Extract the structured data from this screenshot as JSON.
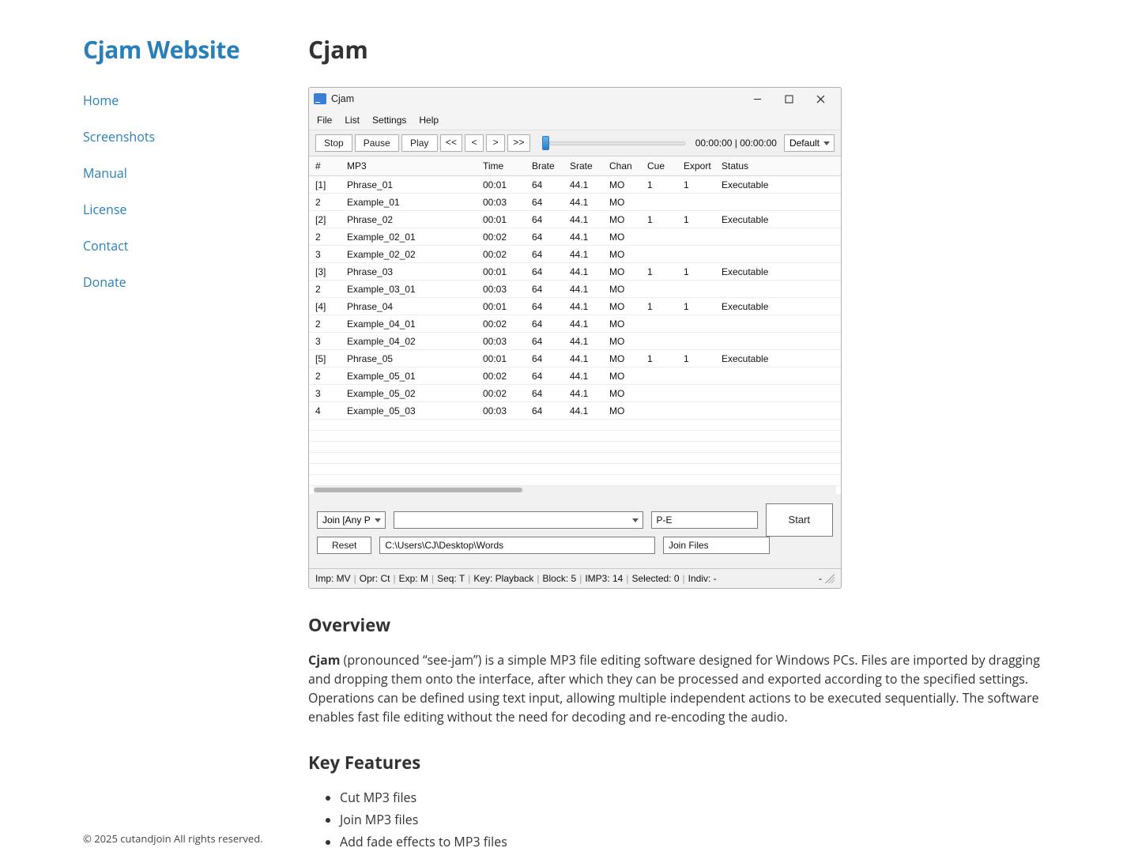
{
  "site": {
    "title": "Cjam Website",
    "nav": [
      {
        "label": "Home"
      },
      {
        "label": "Screenshots"
      },
      {
        "label": "Manual"
      },
      {
        "label": "License"
      },
      {
        "label": "Contact"
      },
      {
        "label": "Donate"
      }
    ],
    "copyright": "© 2025 cutandjoin All rights reserved."
  },
  "page": {
    "heading": "Cjam",
    "overview_heading": "Overview",
    "overview_strong": "Cjam",
    "overview_body": " (pronounced “see-jam”) is a simple MP3 file editing software designed for Windows PCs. Files are imported by dragging and dropping them onto the interface, after which they can be processed and exported according to the specified settings. Operations can be defined using text input, allowing multiple independent actions to be executed sequentially. The software enables fast file editing without the need for decoding and re-encoding the audio.",
    "features_heading": "Key Features",
    "features": [
      "Cut MP3 files",
      "Join MP3 files",
      "Add fade effects to MP3 files"
    ]
  },
  "app": {
    "title": "Cjam",
    "menubar": [
      "File",
      "List",
      "Settings",
      "Help"
    ],
    "toolbar": {
      "stop": "Stop",
      "pause": "Pause",
      "play": "Play",
      "rew2": "<<",
      "rew1": "<",
      "fwd1": ">",
      "fwd2": ">>",
      "time": "00:00:00 | 00:00:00",
      "preset": "Default"
    },
    "columns": [
      "#",
      "MP3",
      "Time",
      "Brate",
      "Srate",
      "Chan",
      "Cue",
      "Export",
      "Status"
    ],
    "rows": [
      {
        "n": "[1]",
        "mp3": "Phrase_01",
        "time": "00:01",
        "brate": "64",
        "srate": "44.1",
        "chan": "MO",
        "cue": "1",
        "export": "1",
        "status": "Executable"
      },
      {
        "n": "2",
        "mp3": "Example_01",
        "time": "00:03",
        "brate": "64",
        "srate": "44.1",
        "chan": "MO",
        "cue": "",
        "export": "",
        "status": ""
      },
      {
        "n": "[2]",
        "mp3": "Phrase_02",
        "time": "00:01",
        "brate": "64",
        "srate": "44.1",
        "chan": "MO",
        "cue": "1",
        "export": "1",
        "status": "Executable"
      },
      {
        "n": "2",
        "mp3": "Example_02_01",
        "time": "00:02",
        "brate": "64",
        "srate": "44.1",
        "chan": "MO",
        "cue": "",
        "export": "",
        "status": ""
      },
      {
        "n": "3",
        "mp3": "Example_02_02",
        "time": "00:02",
        "brate": "64",
        "srate": "44.1",
        "chan": "MO",
        "cue": "",
        "export": "",
        "status": ""
      },
      {
        "n": "[3]",
        "mp3": "Phrase_03",
        "time": "00:01",
        "brate": "64",
        "srate": "44.1",
        "chan": "MO",
        "cue": "1",
        "export": "1",
        "status": "Executable"
      },
      {
        "n": "2",
        "mp3": "Example_03_01",
        "time": "00:03",
        "brate": "64",
        "srate": "44.1",
        "chan": "MO",
        "cue": "",
        "export": "",
        "status": ""
      },
      {
        "n": "[4]",
        "mp3": "Phrase_04",
        "time": "00:01",
        "brate": "64",
        "srate": "44.1",
        "chan": "MO",
        "cue": "1",
        "export": "1",
        "status": "Executable"
      },
      {
        "n": "2",
        "mp3": "Example_04_01",
        "time": "00:02",
        "brate": "64",
        "srate": "44.1",
        "chan": "MO",
        "cue": "",
        "export": "",
        "status": ""
      },
      {
        "n": "3",
        "mp3": "Example_04_02",
        "time": "00:03",
        "brate": "64",
        "srate": "44.1",
        "chan": "MO",
        "cue": "",
        "export": "",
        "status": ""
      },
      {
        "n": "[5]",
        "mp3": "Phrase_05",
        "time": "00:01",
        "brate": "64",
        "srate": "44.1",
        "chan": "MO",
        "cue": "1",
        "export": "1",
        "status": "Executable"
      },
      {
        "n": "2",
        "mp3": "Example_05_01",
        "time": "00:02",
        "brate": "64",
        "srate": "44.1",
        "chan": "MO",
        "cue": "",
        "export": "",
        "status": ""
      },
      {
        "n": "3",
        "mp3": "Example_05_02",
        "time": "00:02",
        "brate": "64",
        "srate": "44.1",
        "chan": "MO",
        "cue": "",
        "export": "",
        "status": ""
      },
      {
        "n": "4",
        "mp3": "Example_05_03",
        "time": "00:03",
        "brate": "64",
        "srate": "44.1",
        "chan": "MO",
        "cue": "",
        "export": "",
        "status": ""
      }
    ],
    "bottom": {
      "join_label": "Join [Any P",
      "reset_label": "Reset",
      "command_value": "",
      "pe_value": "P-E",
      "path_value": "C:\\Users\\CJ\\Desktop\\Words",
      "joinfiles_value": "Join Files",
      "start_label": "Start"
    },
    "status": {
      "items": [
        "Imp: MV",
        "Opr: Ct",
        "Exp: M",
        "Seq: T",
        "Key: Playback",
        "Block: 5",
        "IMP3: 14",
        "Selected: 0",
        "Indiv: -"
      ],
      "right": "-"
    }
  }
}
